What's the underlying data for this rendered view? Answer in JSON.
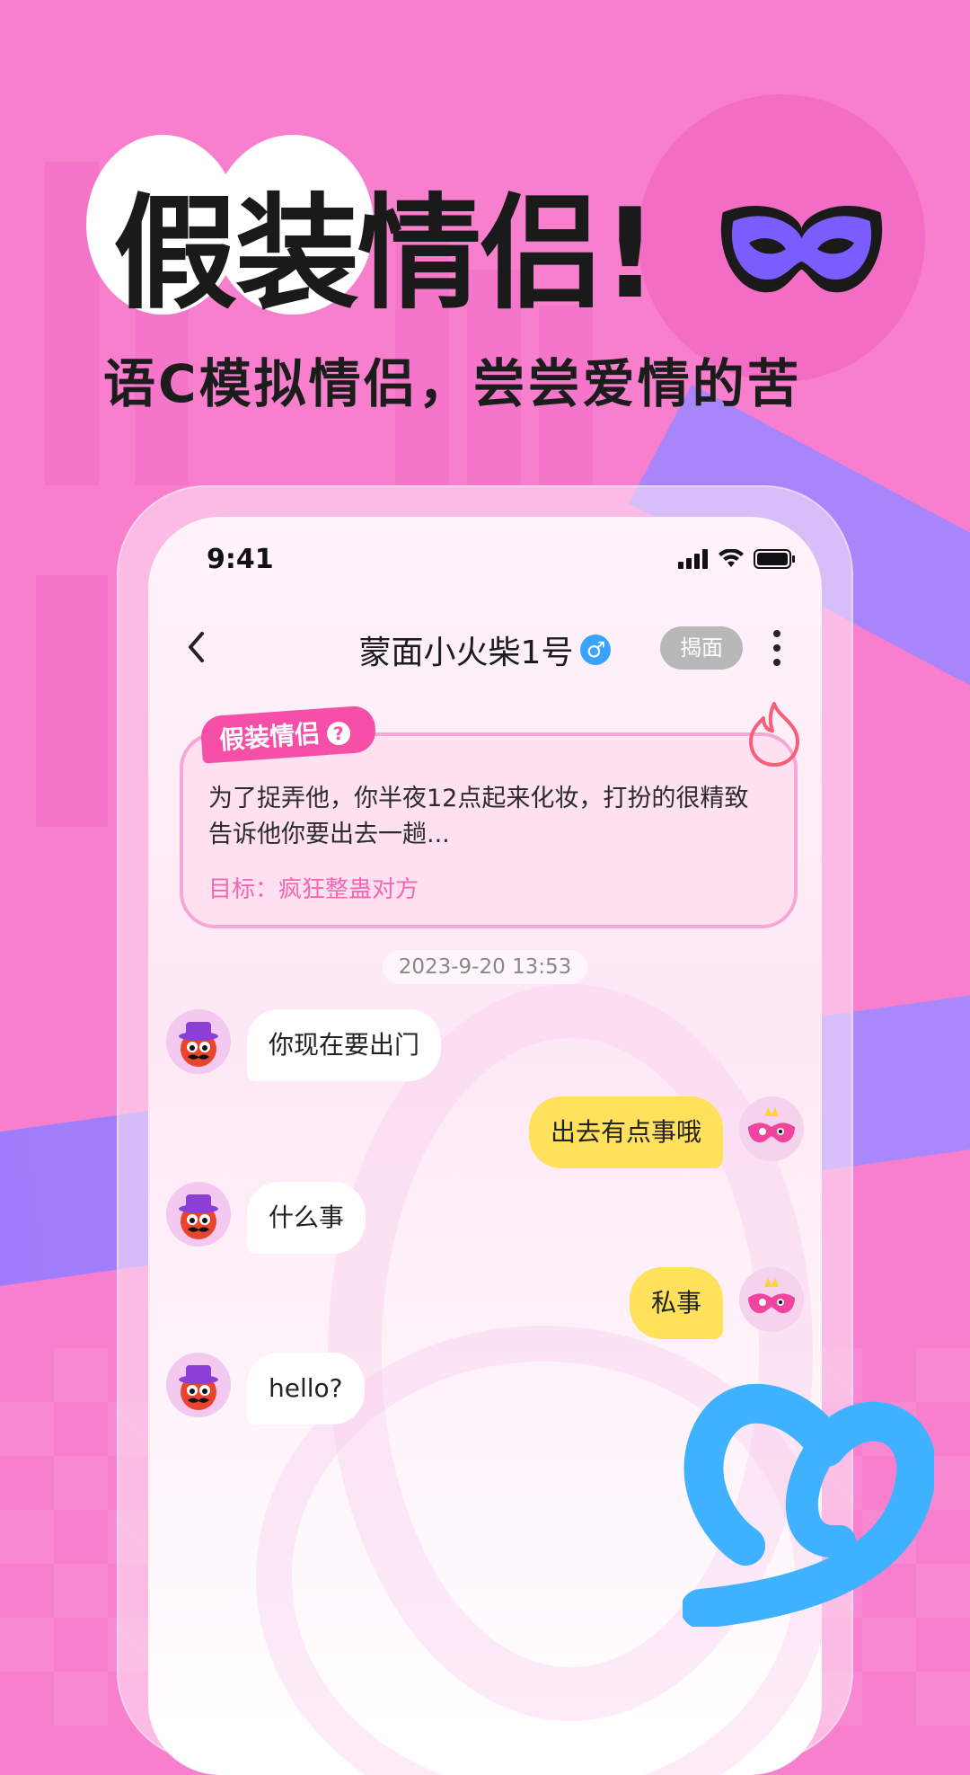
{
  "headline": {
    "title": "假装情侣!",
    "subtitle": "语C模拟情侣，尝尝爱情的苦"
  },
  "status_bar": {
    "time": "9:41"
  },
  "nav": {
    "title": "蒙面小火柴1号",
    "gender": "♂",
    "unmask_label": "揭面"
  },
  "scene": {
    "tag": "假装情侣",
    "help": "?",
    "text": "为了捉弄他，你半夜12点起来化妆，打扮的很精致告诉他你要出去一趟...",
    "goal": "目标：疯狂整蛊对方"
  },
  "chat": {
    "timestamp": "2023-9-20 13:53",
    "messages": [
      {
        "side": "left",
        "text": "你现在要出门"
      },
      {
        "side": "right",
        "text": "出去有点事哦"
      },
      {
        "side": "left",
        "text": "什么事"
      },
      {
        "side": "right",
        "text": "私事"
      },
      {
        "side": "left",
        "text": "hello?"
      }
    ]
  },
  "colors": {
    "background": "#f77fcd",
    "accent_pink": "#f54fa8",
    "bubble_self": "#ffe15c",
    "badge_blue": "#3aa3ff"
  },
  "icons": [
    "mask-icon",
    "back-arrow-icon",
    "gender-male-icon",
    "more-vertical-icon",
    "flame-icon",
    "question-icon",
    "signal-icon",
    "wifi-icon",
    "battery-icon",
    "heart-icon"
  ]
}
